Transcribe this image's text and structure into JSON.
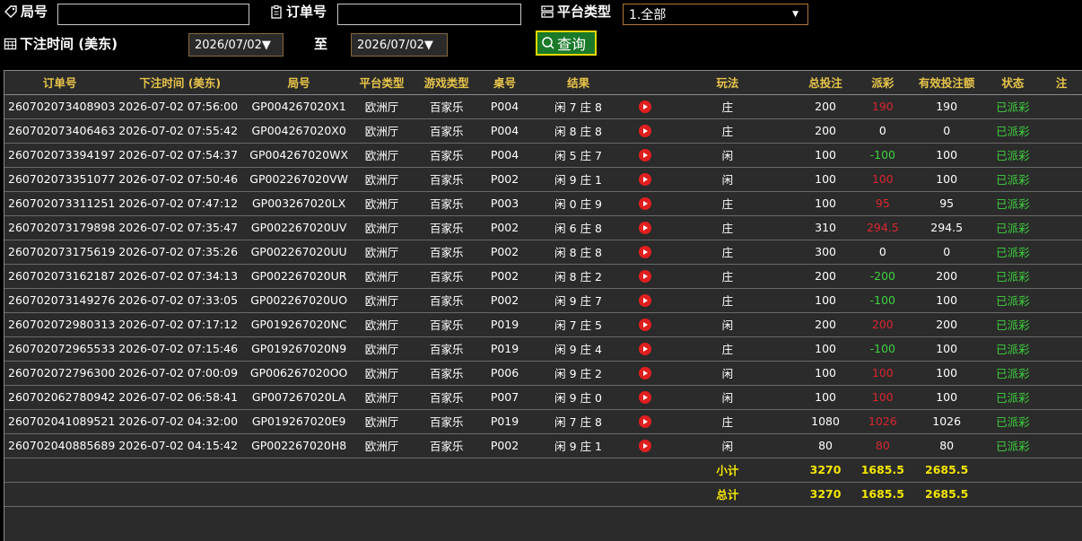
{
  "filters": {
    "round_label": "局号",
    "round_value": "",
    "order_label": "订单号",
    "order_value": "",
    "platform_label": "平台类型",
    "platform_value": "1.全部",
    "time_label": "下注时间 (美东)",
    "date_from": "2026/07/02▼",
    "to_label": "至",
    "date_to": "2026/07/02▼",
    "query_label": "查询"
  },
  "table": {
    "headers": [
      "订单号",
      "下注时间 (美东)",
      "局号",
      "平台类型",
      "游戏类型",
      "桌号",
      "结果",
      "",
      "玩法",
      "总投注",
      "派彩",
      "有效投注额",
      "状态",
      "注"
    ],
    "rows": [
      [
        "260702073408903",
        "2026-07-02 07:56:00",
        "GP004267020X1",
        "欧洲厅",
        "百家乐",
        "P004",
        "闲 7 庄 8",
        "",
        "庄",
        "200",
        "190",
        "190",
        "已派彩",
        ""
      ],
      [
        "260702073406463",
        "2026-07-02 07:55:42",
        "GP004267020X0",
        "欧洲厅",
        "百家乐",
        "P004",
        "闲 8 庄 8",
        "",
        "庄",
        "200",
        "0",
        "0",
        "已派彩",
        ""
      ],
      [
        "260702073394197",
        "2026-07-02 07:54:37",
        "GP004267020WX",
        "欧洲厅",
        "百家乐",
        "P004",
        "闲 5 庄 7",
        "",
        "闲",
        "100",
        "-100",
        "100",
        "已派彩",
        ""
      ],
      [
        "260702073351077",
        "2026-07-02 07:50:46",
        "GP002267020VW",
        "欧洲厅",
        "百家乐",
        "P002",
        "闲 9 庄 1",
        "",
        "闲",
        "100",
        "100",
        "100",
        "已派彩",
        ""
      ],
      [
        "260702073311251",
        "2026-07-02 07:47:12",
        "GP003267020LX",
        "欧洲厅",
        "百家乐",
        "P003",
        "闲 0 庄 9",
        "",
        "庄",
        "100",
        "95",
        "95",
        "已派彩",
        ""
      ],
      [
        "260702073179898",
        "2026-07-02 07:35:47",
        "GP002267020UV",
        "欧洲厅",
        "百家乐",
        "P002",
        "闲 6 庄 8",
        "",
        "庄",
        "310",
        "294.5",
        "294.5",
        "已派彩",
        ""
      ],
      [
        "260702073175619",
        "2026-07-02 07:35:26",
        "GP002267020UU",
        "欧洲厅",
        "百家乐",
        "P002",
        "闲 8 庄 8",
        "",
        "庄",
        "300",
        "0",
        "0",
        "已派彩",
        ""
      ],
      [
        "260702073162187",
        "2026-07-02 07:34:13",
        "GP002267020UR",
        "欧洲厅",
        "百家乐",
        "P002",
        "闲 8 庄 2",
        "",
        "庄",
        "200",
        "-200",
        "200",
        "已派彩",
        ""
      ],
      [
        "260702073149276",
        "2026-07-02 07:33:05",
        "GP002267020UO",
        "欧洲厅",
        "百家乐",
        "P002",
        "闲 9 庄 7",
        "",
        "庄",
        "100",
        "-100",
        "100",
        "已派彩",
        ""
      ],
      [
        "260702072980313",
        "2026-07-02 07:17:12",
        "GP019267020NC",
        "欧洲厅",
        "百家乐",
        "P019",
        "闲 7 庄 5",
        "",
        "闲",
        "200",
        "200",
        "200",
        "已派彩",
        ""
      ],
      [
        "260702072965533",
        "2026-07-02 07:15:46",
        "GP019267020N9",
        "欧洲厅",
        "百家乐",
        "P019",
        "闲 9 庄 4",
        "",
        "庄",
        "100",
        "-100",
        "100",
        "已派彩",
        ""
      ],
      [
        "260702072796300",
        "2026-07-02 07:00:09",
        "GP006267020OO",
        "欧洲厅",
        "百家乐",
        "P006",
        "闲 9 庄 2",
        "",
        "闲",
        "100",
        "100",
        "100",
        "已派彩",
        ""
      ],
      [
        "260702062780942",
        "2026-07-02 06:58:41",
        "GP007267020LA",
        "欧洲厅",
        "百家乐",
        "P007",
        "闲 9 庄 0",
        "",
        "闲",
        "100",
        "100",
        "100",
        "已派彩",
        ""
      ],
      [
        "260702041089521",
        "2026-07-02 04:32:00",
        "GP019267020E9",
        "欧洲厅",
        "百家乐",
        "P019",
        "闲 7 庄 8",
        "",
        "庄",
        "1080",
        "1026",
        "1026",
        "已派彩",
        ""
      ],
      [
        "260702040885689",
        "2026-07-02 04:15:42",
        "GP002267020H8",
        "欧洲厅",
        "百家乐",
        "P002",
        "闲 9 庄 1",
        "",
        "闲",
        "80",
        "80",
        "80",
        "已派彩",
        ""
      ]
    ],
    "subtotal": {
      "label": "小计",
      "total_bet": "3270",
      "payout": "1685.5",
      "valid_bet": "2685.5"
    },
    "grand_total": {
      "label": "总计",
      "total_bet": "3270",
      "payout": "1685.5",
      "valid_bet": "2685.5"
    }
  },
  "colors": {
    "header_text": "#e8c44a",
    "positive": "#d8262f",
    "negative": "#3ed23e",
    "status": "#3ed23e",
    "sum_text": "#f2e600",
    "row_bg": "#2b2b2b",
    "play_icon": "#e01f1f"
  }
}
